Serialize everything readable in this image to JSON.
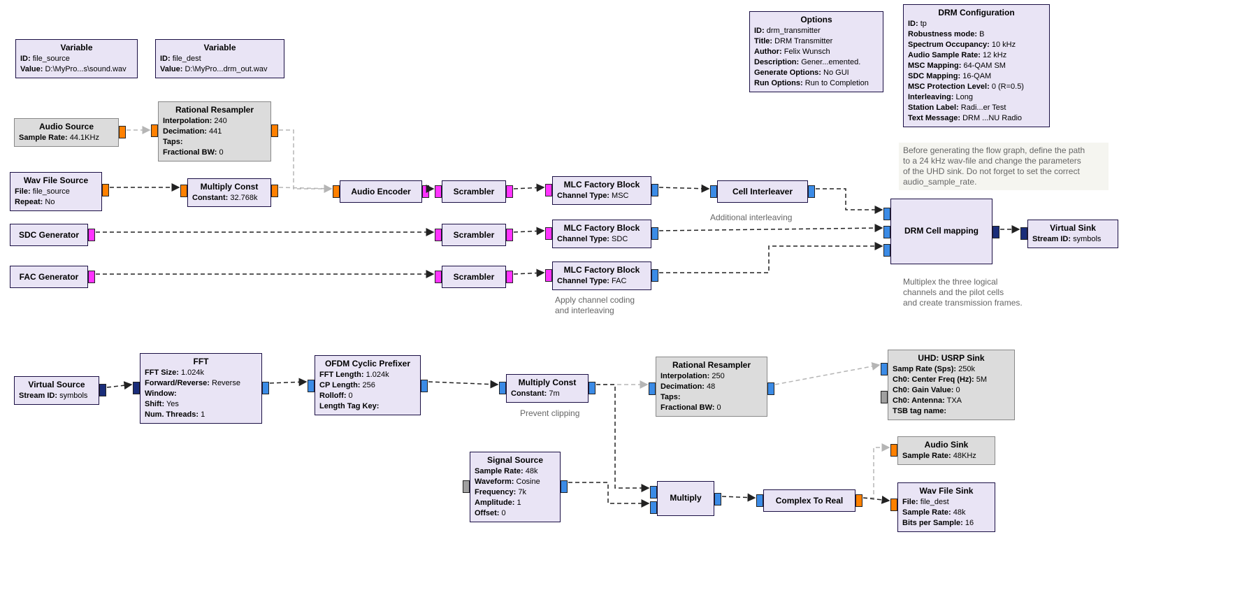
{
  "var1": {
    "title": "Variable",
    "id_l": "ID:",
    "id": "file_source",
    "val_l": "Value:",
    "val": "D:\\MyPro...s\\sound.wav"
  },
  "var2": {
    "title": "Variable",
    "id_l": "ID:",
    "id": "file_dest",
    "val_l": "Value:",
    "val": "D:\\MyPro...drm_out.wav"
  },
  "options": {
    "title": "Options",
    "id_l": "ID:",
    "id": "drm_transmitter",
    "ttl_l": "Title:",
    "ttl": "DRM Transmitter",
    "auth_l": "Author:",
    "auth": "Felix Wunsch",
    "desc_l": "Description:",
    "desc": "Gener...emented.",
    "gen_l": "Generate Options:",
    "gen": "No GUI",
    "run_l": "Run Options:",
    "run": "Run to Completion"
  },
  "drmcfg": {
    "title": "DRM Configuration",
    "id_l": "ID:",
    "id": "tp",
    "rob_l": "Robustness mode:",
    "rob": "B",
    "spec_l": "Spectrum Occupancy:",
    "spec": "10 kHz",
    "asr_l": "Audio Sample Rate:",
    "asr": "12 kHz",
    "msc_l": "MSC Mapping:",
    "msc": "64-QAM SM",
    "sdc_l": "SDC Mapping:",
    "sdc": "16-QAM",
    "prot_l": "MSC Protection Level:",
    "prot": "0 (R=0.5)",
    "intl_l": "Interleaving:",
    "intl": "Long",
    "stn_l": "Station Label:",
    "stn": "Radi...er Test",
    "txt_l": "Text Message:",
    "txt": "DRM ...NU Radio"
  },
  "audio_src": {
    "title": "Audio Source",
    "sr_l": "Sample Rate:",
    "sr": "44.1KHz"
  },
  "resamp1": {
    "title": "Rational Resampler",
    "int_l": "Interpolation:",
    "int": "240",
    "dec_l": "Decimation:",
    "dec": "441",
    "taps_l": "Taps:",
    "fbw_l": "Fractional BW:",
    "fbw": "0"
  },
  "wavsrc": {
    "title": "Wav File Source",
    "file_l": "File:",
    "file": "file_source",
    "rep_l": "Repeat:",
    "rep": "No"
  },
  "mconst1": {
    "title": "Multiply Const",
    "c_l": "Constant:",
    "c": "32.768k"
  },
  "aenc": {
    "title": "Audio Encoder"
  },
  "scr1": {
    "title": "Scrambler"
  },
  "scr2": {
    "title": "Scrambler"
  },
  "scr3": {
    "title": "Scrambler"
  },
  "sdcgen": {
    "title": "SDC Generator"
  },
  "facgen": {
    "title": "FAC Generator"
  },
  "mlc1": {
    "title": "MLC Factory Block",
    "ct_l": "Channel Type:",
    "ct": "MSC"
  },
  "mlc2": {
    "title": "MLC Factory Block",
    "ct_l": "Channel Type:",
    "ct": "SDC"
  },
  "mlc3": {
    "title": "MLC Factory Block",
    "ct_l": "Channel Type:",
    "ct": "FAC"
  },
  "cellint": {
    "title": "Cell Interleaver"
  },
  "drmmap": {
    "title": "DRM Cell mapping"
  },
  "vsink": {
    "title": "Virtual Sink",
    "id_l": "Stream ID:",
    "id": "symbols"
  },
  "vsrc": {
    "title": "Virtual Source",
    "id_l": "Stream ID:",
    "id": "symbols"
  },
  "fft": {
    "title": "FFT",
    "sz_l": "FFT Size:",
    "sz": "1.024k",
    "dir_l": "Forward/Reverse:",
    "dir": "Reverse",
    "win_l": "Window:",
    "sh_l": "Shift:",
    "sh": "Yes",
    "nt_l": "Num. Threads:",
    "nt": "1"
  },
  "ofdm": {
    "title": "OFDM Cyclic Prefixer",
    "fl_l": "FFT Length:",
    "fl": "1.024k",
    "cp_l": "CP Length:",
    "cp": "256",
    "ro_l": "Rolloff:",
    "ro": "0",
    "tag_l": "Length Tag Key:"
  },
  "mconst2": {
    "title": "Multiply Const",
    "c_l": "Constant:",
    "c": "7m"
  },
  "resamp2": {
    "title": "Rational Resampler",
    "int_l": "Interpolation:",
    "int": "250",
    "dec_l": "Decimation:",
    "dec": "48",
    "taps_l": "Taps:",
    "fbw_l": "Fractional BW:",
    "fbw": "0"
  },
  "usrp": {
    "title": "UHD: USRP Sink",
    "sr_l": "Samp Rate (Sps):",
    "sr": "250k",
    "cf_l": "Ch0: Center Freq (Hz):",
    "cf": "5M",
    "gv_l": "Ch0: Gain Value:",
    "gv": "0",
    "ant_l": "Ch0: Antenna:",
    "ant": "TXA",
    "tsb_l": "TSB tag name:"
  },
  "sigsrc": {
    "title": "Signal Source",
    "sr_l": "Sample Rate:",
    "sr": "48k",
    "wf_l": "Waveform:",
    "wf": "Cosine",
    "fr_l": "Frequency:",
    "fr": "7k",
    "amp_l": "Amplitude:",
    "amp": "1",
    "off_l": "Offset:",
    "off": "0"
  },
  "mult": {
    "title": "Multiply"
  },
  "c2r": {
    "title": "Complex To Real"
  },
  "asink": {
    "title": "Audio Sink",
    "sr_l": "Sample Rate:",
    "sr": "48KHz"
  },
  "wavsink": {
    "title": "Wav File Sink",
    "file_l": "File:",
    "file": "file_dest",
    "sr_l": "Sample Rate:",
    "sr": "48k",
    "bps_l": "Bits per Sample:",
    "bps": "16"
  },
  "notes": {
    "top": "Before generating the flow graph, define the path\nto a 24 kHz wav-file and change the parameters\nof the UHD sink. Do not forget to set the correct\naudio_sample_rate.",
    "cellint": "Additional interleaving",
    "coding": "Apply channel coding\nand interleaving",
    "mux": "Multiplex the three logical\nchannels and the pilot cells\nand create transmission frames.",
    "clip": "Prevent clipping"
  }
}
